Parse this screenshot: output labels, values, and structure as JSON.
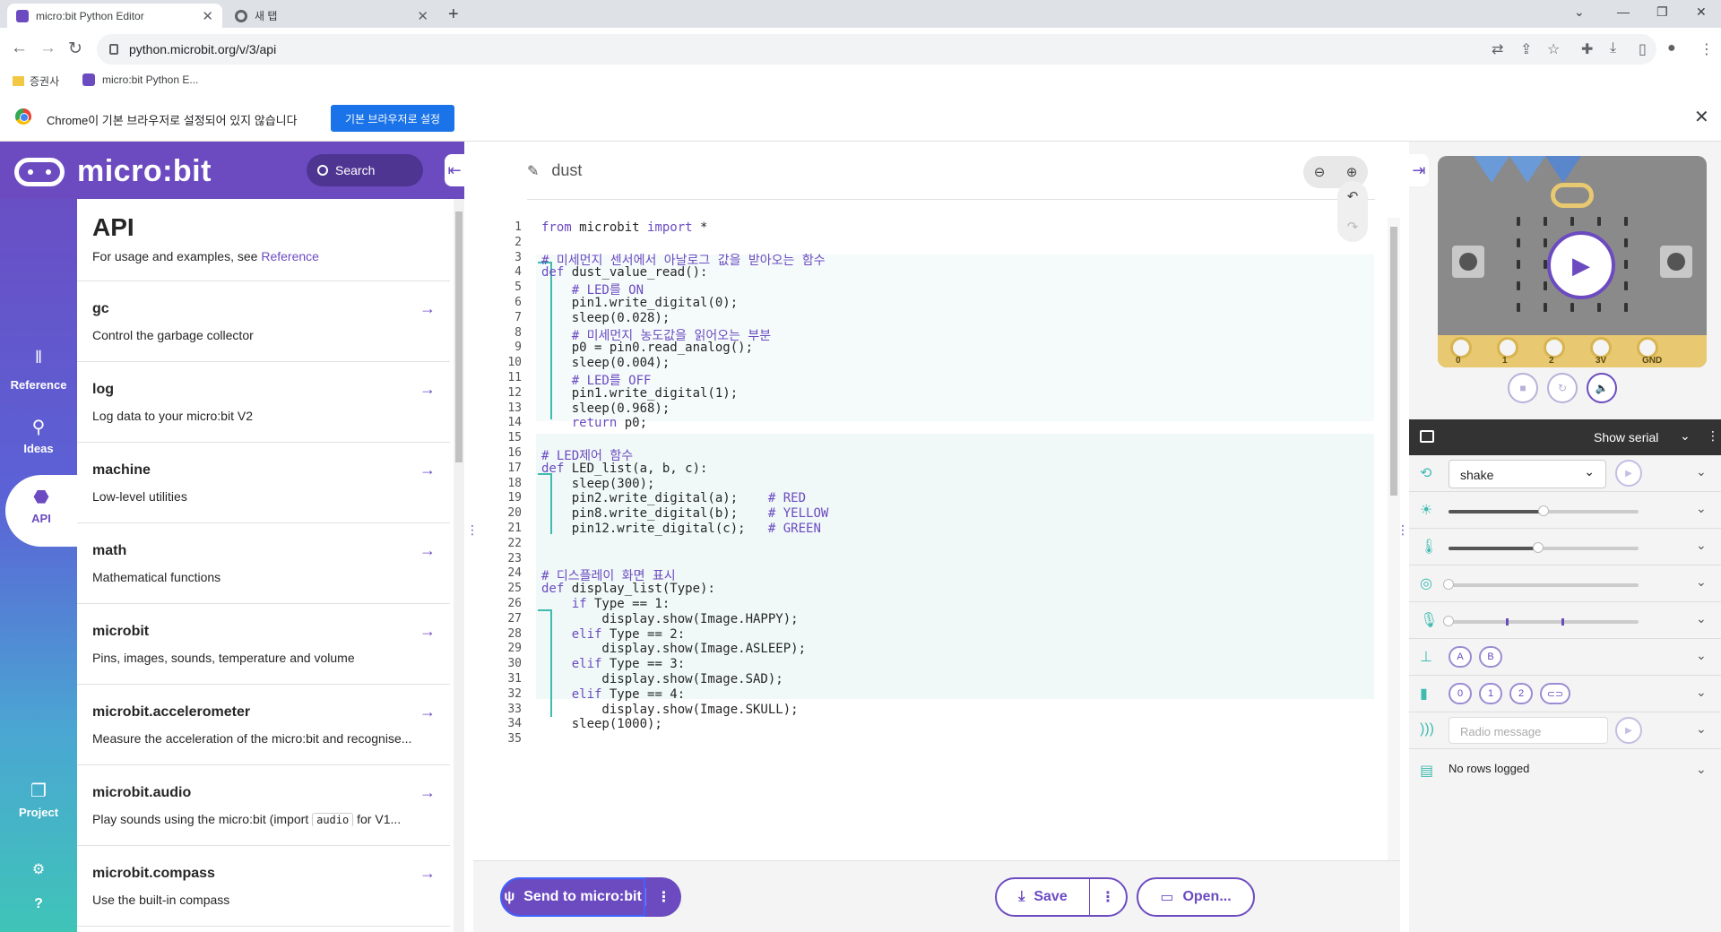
{
  "browser": {
    "tabs": [
      {
        "title": "micro:bit Python Editor"
      },
      {
        "title": "새 탭"
      }
    ],
    "url": "python.microbit.org/v/3/api",
    "bookmarks": [
      "증권사",
      "micro:bit Python E..."
    ],
    "infobar": {
      "message": "Chrome이 기본 브라우저로 설정되어 있지 않습니다",
      "button": "기본 브라우저로 설정"
    }
  },
  "app": {
    "logo": "micro:bit",
    "search": "Search",
    "nav": [
      {
        "label": "Reference",
        "icon": "books-icon"
      },
      {
        "label": "Ideas",
        "icon": "bulb-icon"
      },
      {
        "label": "API",
        "icon": "python-icon"
      },
      {
        "label": "Project",
        "icon": "files-icon"
      }
    ],
    "api": {
      "title": "API",
      "subtitle": "For usage and examples, see",
      "subtitle_link": "Reference",
      "items": [
        {
          "title": "gc",
          "desc": "Control the garbage collector"
        },
        {
          "title": "log",
          "desc": "Log data to your micro:bit V2"
        },
        {
          "title": "machine",
          "desc": "Low-level utilities"
        },
        {
          "title": "math",
          "desc": "Mathematical functions"
        },
        {
          "title": "microbit",
          "desc": "Pins, images, sounds, temperature and volume"
        },
        {
          "title": "microbit.accelerometer",
          "desc": "Measure the acceleration of the micro:bit and recognise..."
        },
        {
          "title": "microbit.audio",
          "desc_pre": "Play sounds using the micro:bit (import",
          "desc_code": "audio",
          "desc_post": "for V1..."
        },
        {
          "title": "microbit.compass",
          "desc": "Use the built-in compass"
        }
      ]
    },
    "editor": {
      "filename": "dust",
      "send": "Send to micro:bit",
      "save": "Save",
      "open": "Open...",
      "lines": [
        "from microbit import *",
        "",
        "# 미세먼지 센서에서 아날로그 값을 받아오는 함수",
        "def dust_value_read():",
        "    # LED를 ON",
        "    pin1.write_digital(0);",
        "    sleep(0.028);",
        "    # 미세먼지 농도값을 읽어오는 부분",
        "    p0 = pin0.read_analog();",
        "    sleep(0.004);",
        "    # LED를 OFF",
        "    pin1.write_digital(1);",
        "    sleep(0.968);",
        "    return p0;",
        "",
        "# LED제어 함수",
        "def LED_list(a, b, c):",
        "    sleep(300);",
        "    pin2.write_digital(a);    # RED",
        "    pin8.write_digital(b);    # YELLOW",
        "    pin12.write_digital(c);   # GREEN",
        "",
        "",
        "# 디스플레이 화면 표시",
        "def display_list(Type):",
        "    if Type == 1:",
        "        display.show(Image.HAPPY);",
        "    elif Type == 2:",
        "        display.show(Image.ASLEEP);",
        "    elif Type == 3:",
        "        display.show(Image.SAD);",
        "    elif Type == 4:",
        "        display.show(Image.SKULL);",
        "    sleep(1000);",
        ""
      ]
    },
    "simulator": {
      "pins": [
        "0",
        "1",
        "2",
        "3V",
        "GND"
      ],
      "serial": "Show serial",
      "gesture": "shake",
      "buttons": [
        "A",
        "B"
      ],
      "touch_pins": [
        "0",
        "1",
        "2"
      ],
      "radio_placeholder": "Radio message",
      "log": "No rows logged",
      "sliders": {
        "light": 0.5,
        "temperature": 0.47,
        "compass": 0.0
      }
    }
  },
  "colors": {
    "accent": "#6c4bc1",
    "teal": "#3fbbb1"
  }
}
